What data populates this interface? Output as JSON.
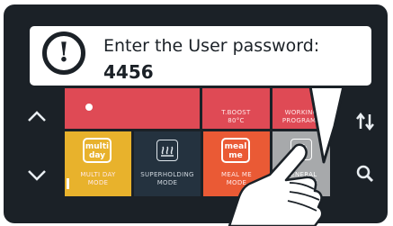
{
  "dialog": {
    "prompt": "Enter the User password:",
    "password": "4456",
    "icon": "exclamation-icon"
  },
  "side_controls": {
    "up_icon": "chevron-up-icon",
    "down_icon": "chevron-down-icon",
    "sort_icon": "sort-arrows-icon",
    "search_icon": "search-icon"
  },
  "top_row": [
    {
      "label": "T.BOOST\n80°C"
    },
    {
      "label": "WORKING\nPROGRAMS"
    }
  ],
  "tiles": [
    {
      "icon_text": "multi\nday",
      "label": "MULTI DAY\nMODE",
      "icon": "multi-day-icon"
    },
    {
      "label": "SUPERHOLDING\nMODE",
      "icon": "steam-icon"
    },
    {
      "icon_text": "meal\nme",
      "label": "MEAL ME\nMODE",
      "icon": "meal-me-icon"
    },
    {
      "label": "GENERAL\nSETTINGS",
      "icon": "gear-icon"
    }
  ],
  "colors": {
    "panel": "#1b2127",
    "red_tile": "#df4a55",
    "yellow_tile": "#e8b22c",
    "navy_tile": "#24323f",
    "orange_tile": "#ea5a35",
    "gray_tile": "#a7a9ab"
  }
}
